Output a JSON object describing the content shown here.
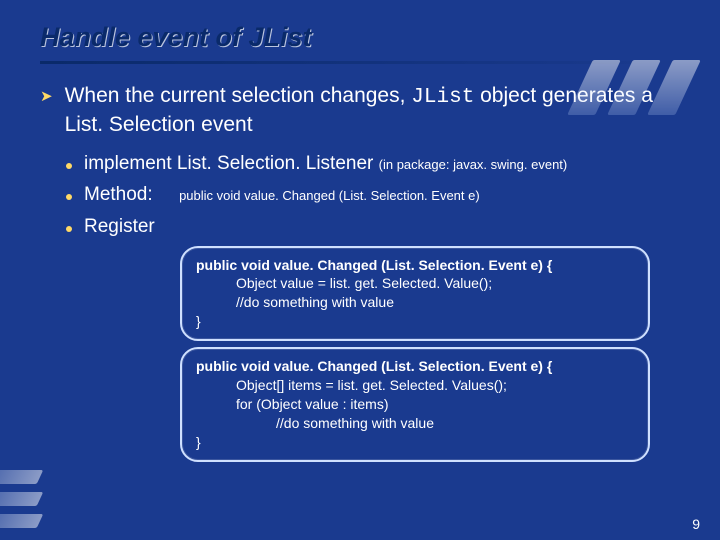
{
  "title": "Handle event of JList",
  "main": {
    "l1_before": "When the current selection changes, ",
    "l1_code": "JList",
    "l1_after": " object generates a List. Selection event"
  },
  "bul": {
    "b1_before": "implement List. Selection. Listener ",
    "b1_small": "(in package: javax. swing. event)",
    "b2_label": "Method:",
    "b2_sig": "public void value. Changed (List. Selection. Event e)",
    "b3_label": "Register"
  },
  "code1": {
    "sig": "public void value. Changed (List. Selection. Event e) {",
    "l1": "Object value = list. get. Selected. Value();",
    "l2": "//do something with value",
    "close": "}"
  },
  "code2": {
    "sig": "public void value. Changed (List. Selection. Event e) {",
    "l1": "Object[] items = list. get. Selected. Values();",
    "l2": "for (Object value : items)",
    "l3": "//do something with value",
    "close": "}"
  },
  "page": "9"
}
